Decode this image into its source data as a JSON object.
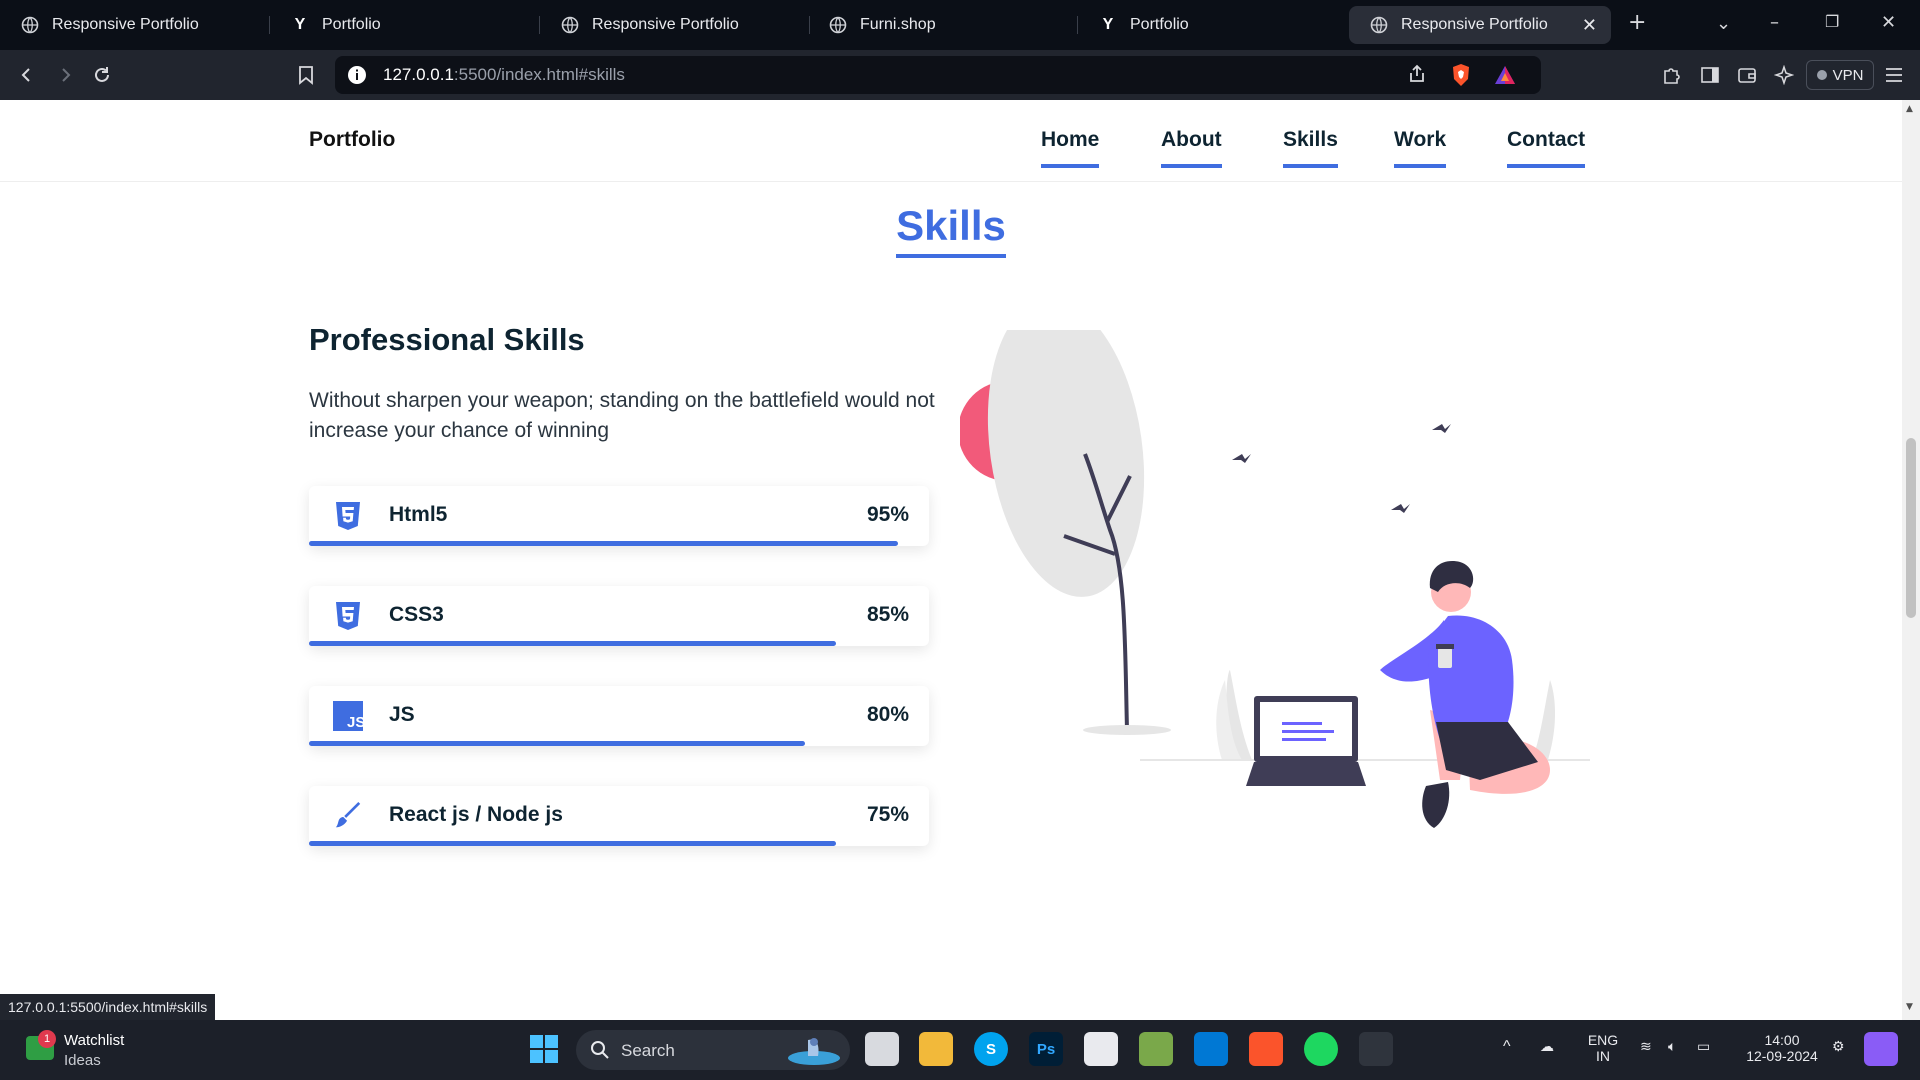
{
  "browser": {
    "tabs": [
      {
        "label": "Responsive Portfolio",
        "icon": "globe-icon"
      },
      {
        "label": "Portfolio",
        "icon": "y-icon"
      },
      {
        "label": "Responsive Portfolio",
        "icon": "globe-icon"
      },
      {
        "label": "Furni.shop",
        "icon": "globe-icon"
      },
      {
        "label": "Portfolio",
        "icon": "y-icon"
      },
      {
        "label": "Responsive Portfolio",
        "icon": "globe-icon",
        "active": true
      }
    ],
    "url_host": "127.0.0.1",
    "url_rest": ":5500/index.html#skills",
    "vpn_label": "VPN",
    "status_url": "127.0.0.1:5500/index.html#skills"
  },
  "nav": {
    "logo": "Portfolio",
    "links": [
      "Home",
      "About",
      "Skills",
      "Work",
      "Contact"
    ]
  },
  "section": {
    "heading": "Skills",
    "pro_title": "Professional Skills",
    "description": "Without sharpen your weapon; standing on the battlefield would not increase your chance of winning"
  },
  "skills": [
    {
      "name": "Html5",
      "percent_label": "95%",
      "level": 0.95,
      "icon": "html5-icon"
    },
    {
      "name": "CSS3",
      "percent_label": "85%",
      "level": 0.85,
      "icon": "css3-icon"
    },
    {
      "name": "JS",
      "percent_label": "80%",
      "level": 0.8,
      "icon": "js-icon"
    },
    {
      "name": "React js / Node js",
      "percent_label": "75%",
      "level": 0.85,
      "icon": "brush-icon"
    }
  ],
  "taskbar": {
    "widget_title": "Watchlist",
    "widget_sub": "Ideas",
    "widget_badge": "1",
    "search_label": "Search",
    "lang_top": "ENG",
    "lang_bottom": "IN",
    "time": "14:00",
    "date": "12-09-2024"
  },
  "colors": {
    "accent": "#3f6de0",
    "heading_text": "#0e2431",
    "illustration_pink": "#f25a7a",
    "illustration_purple": "#6c63ff"
  }
}
